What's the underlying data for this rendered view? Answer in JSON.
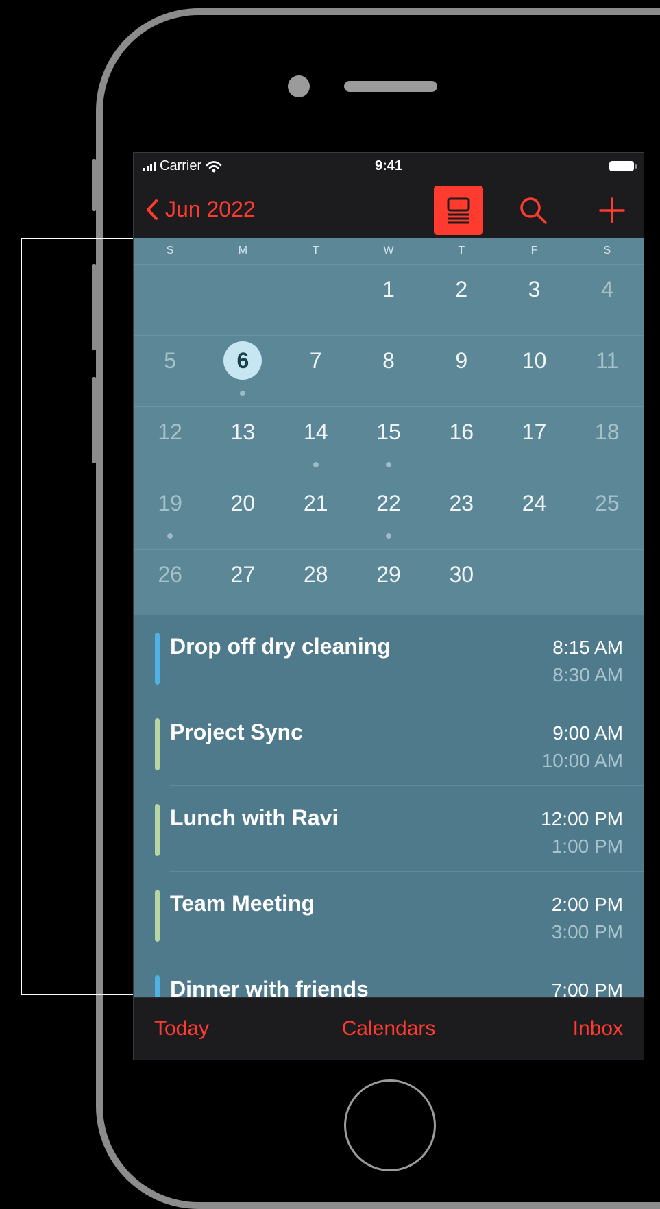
{
  "status_bar": {
    "carrier": "Carrier",
    "time": "9:41"
  },
  "nav": {
    "month_year": "Jun 2022"
  },
  "calendar": {
    "weekdays": [
      "S",
      "M",
      "T",
      "W",
      "T",
      "F",
      "S"
    ],
    "selected_day": "6",
    "weeks": [
      [
        "",
        "",
        "",
        "1",
        "2",
        "3",
        "4"
      ],
      [
        "5",
        "6",
        "7",
        "8",
        "9",
        "10",
        "11"
      ],
      [
        "12",
        "13",
        "14",
        "15",
        "16",
        "17",
        "18"
      ],
      [
        "19",
        "20",
        "21",
        "22",
        "23",
        "24",
        "25"
      ],
      [
        "26",
        "27",
        "28",
        "29",
        "30",
        "",
        ""
      ]
    ],
    "days_with_events": [
      "6",
      "14",
      "15",
      "19",
      "22"
    ]
  },
  "events": [
    {
      "title": "Drop off dry cleaning",
      "start": "8:15 AM",
      "end": "8:30 AM",
      "color": "#4fb2e4"
    },
    {
      "title": "Project Sync",
      "start": "9:00 AM",
      "end": "10:00 AM",
      "color": "#b7d6a3"
    },
    {
      "title": "Lunch with Ravi",
      "start": "12:00 PM",
      "end": "1:00 PM",
      "color": "#b7d6a3"
    },
    {
      "title": "Team Meeting",
      "start": "2:00 PM",
      "end": "3:00 PM",
      "color": "#b7d6a3"
    },
    {
      "title": "Dinner with friends",
      "start": "7:00 PM",
      "end": "",
      "color": "#4fb2e4"
    }
  ],
  "tabbar": {
    "today": "Today",
    "calendars": "Calendars",
    "inbox": "Inbox"
  },
  "colors": {
    "accent": "#ff3b30",
    "calendar_bg": "#5b8797",
    "events_bg": "#4e7a8b"
  },
  "icons": {
    "back": "chevron-left-icon",
    "list_view": "list-view-icon",
    "search": "search-icon",
    "add": "plus-icon"
  }
}
